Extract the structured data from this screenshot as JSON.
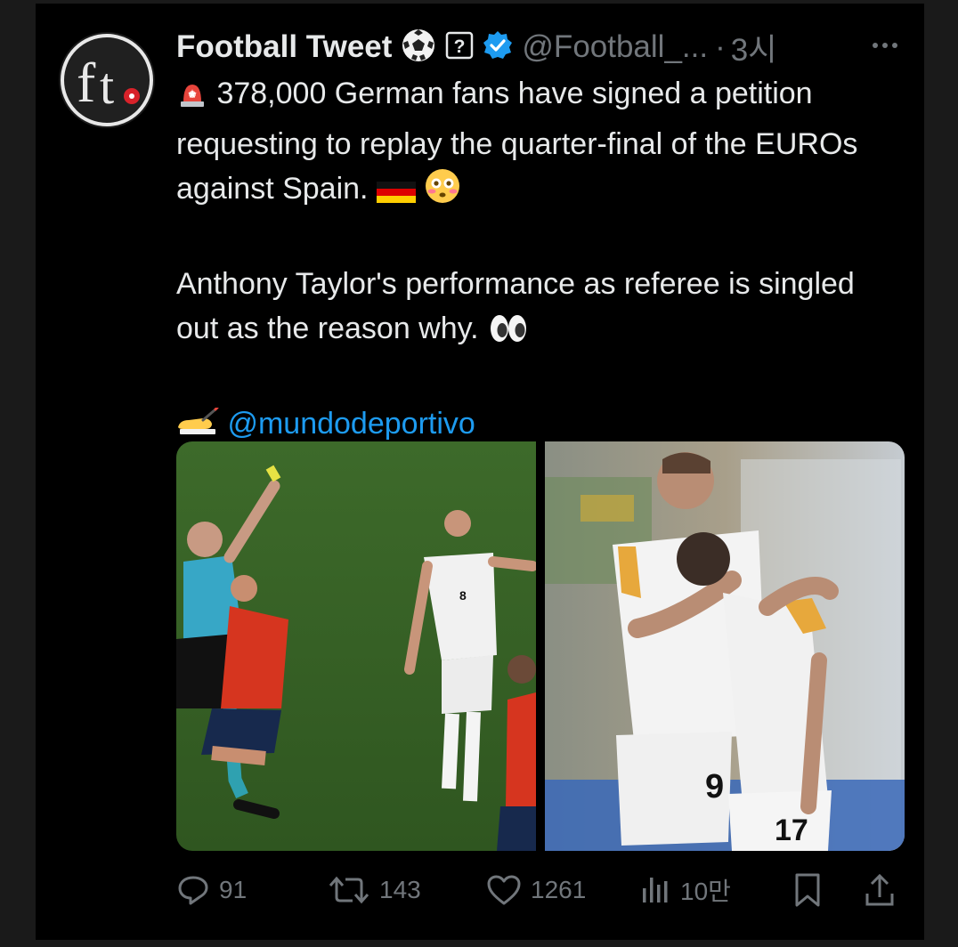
{
  "tweet": {
    "author": {
      "name": "Football Tweet",
      "handle": "@Football_...",
      "avatar_text": "ft",
      "badges": [
        "soccer-ball-icon",
        "help-box-icon",
        "verified-badge-icon"
      ]
    },
    "separator": "·",
    "timestamp": "3시",
    "body": {
      "line1": "378,000 German fans have signed a petition requesting to replay the quarter-final of the EUROs against Spain.",
      "line2": "Anthony Taylor's performance as referee is singled out as the reason why.",
      "source_mention": "@mundodeportivo"
    },
    "emojis": [
      "police-light-emoji",
      "german-flag-emoji",
      "flushed-face-emoji",
      "eyes-emoji",
      "writing-hand-emoji"
    ],
    "media": [
      {
        "name": "referee-yellow-card-photo"
      },
      {
        "name": "german-players-embrace-photo"
      }
    ],
    "stats": {
      "replies": "91",
      "reposts": "143",
      "likes": "1261",
      "views": "10만"
    },
    "colors": {
      "background": "#000000",
      "text": "#e7e9ea",
      "muted": "#71767b",
      "link": "#1d9bf0",
      "verified": "#1d9bf0"
    }
  }
}
